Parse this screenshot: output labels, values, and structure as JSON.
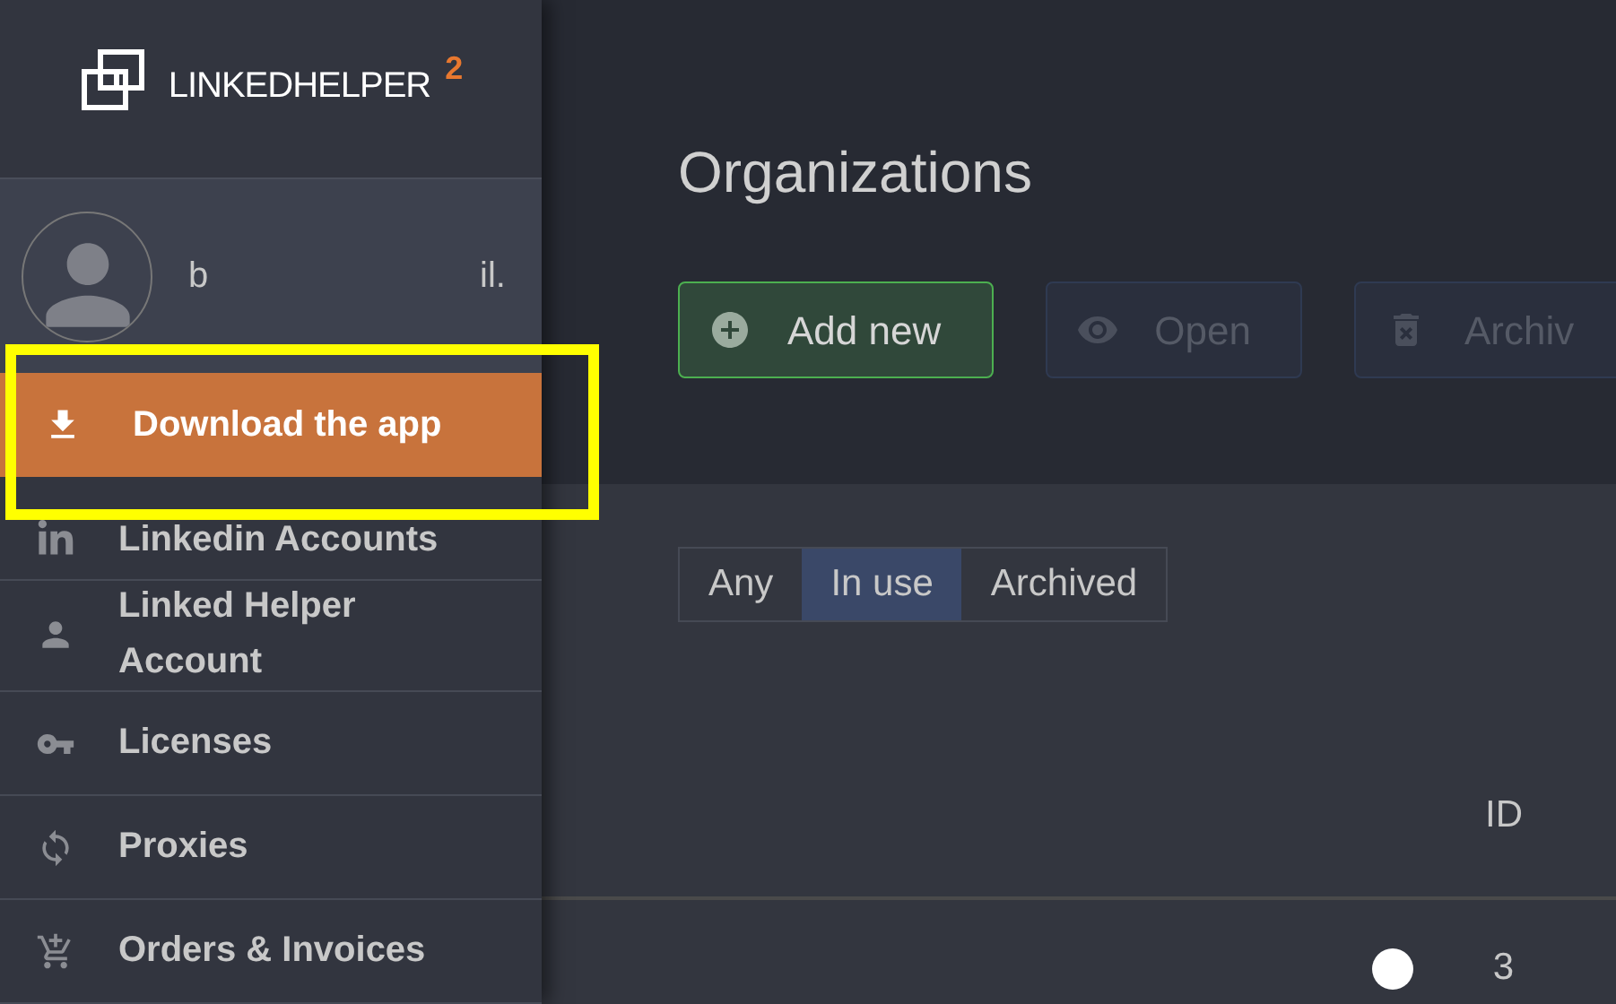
{
  "logo": {
    "text": "LINKEDHELPER",
    "version": "2"
  },
  "user": {
    "name_start": "b",
    "name_end": "il."
  },
  "download_button": {
    "label": "Download the app"
  },
  "sidebar": {
    "items": [
      {
        "kind": "linkedin",
        "label": "Linkedin Accounts"
      },
      {
        "kind": "person",
        "label": "Linked Helper Account"
      },
      {
        "kind": "key",
        "label": "Licenses"
      },
      {
        "kind": "sync",
        "label": "Proxies"
      },
      {
        "kind": "cart",
        "label": "Orders & Invoices"
      }
    ]
  },
  "page": {
    "title": "Organizations"
  },
  "toolbar": [
    {
      "kind": "add",
      "label": "Add new",
      "disabled": false
    },
    {
      "kind": "open",
      "label": "Open",
      "disabled": true
    },
    {
      "kind": "archive",
      "label": "Archiv",
      "disabled": true
    }
  ],
  "filters": [
    {
      "label": "Any",
      "selected": false
    },
    {
      "label": "In use",
      "selected": true
    },
    {
      "label": "Archived",
      "selected": false
    }
  ],
  "table": {
    "columns": [
      "ID"
    ],
    "rows": [
      {
        "color": "#ffffff",
        "id": "3"
      }
    ]
  }
}
